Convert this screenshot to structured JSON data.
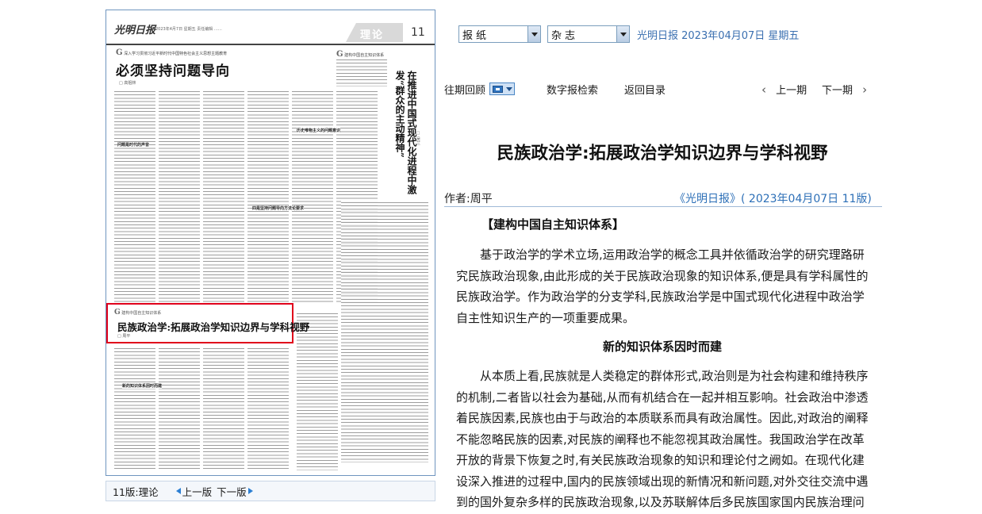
{
  "colors": {
    "highlight_border": "#e0001b",
    "link_blue": "#2c6fb7",
    "frame_blue": "#6f95bf"
  },
  "newspaper": {
    "logo": "光明日报",
    "meta_line": "2023年4月7日  星期五  责任编辑 ……",
    "section": "理论",
    "page_number": "11",
    "lead_kicker": "深入学习贯彻习近平新时代中国特色社会主义思想主题教育",
    "lead_headline": "必须坚持问题导向",
    "lead_byline": "□ 高祖林",
    "side_vertical_title": "在推进中国式现代化进程中激发“群众的主动精神”",
    "side_vertical_byline": "□ 吴兰",
    "side_kicker": "建构中国自主知识体系",
    "subheads": [
      "问题是时代的声音",
      "四是坚持问题导向方法论要求",
      "历史唯物主义的问题意识",
      "新的知识体系因时而建"
    ],
    "highlight_kicker": "建构中国自主知识体系",
    "highlight_title": "民族政治学:拓展政治学知识边界与学科视野",
    "highlight_byline": "□ 周平"
  },
  "edition_nav": {
    "current": "11版:理论",
    "prev_label": "上一版",
    "next_label": "下一版"
  },
  "toolbar": {
    "select_paper": "报纸",
    "select_magazine": "杂志",
    "date_line": "光明日报  2023年04月07日  星期五",
    "past_review": "往期回顾",
    "digital_search": "数字报检索",
    "back_to_toc": "返回目录",
    "prev_issue": "上一期",
    "next_issue": "下一期"
  },
  "article": {
    "title": "民族政治学:拓展政治学知识边界与学科视野",
    "author": "作者:周平",
    "source": "《光明日报》( 2023年04月07日  11版)",
    "section_heading": "【建构中国自主知识体系】",
    "para1": "基于政治学的学术立场,运用政治学的概念工具并依循政治学的研究理路研究民族政治现象,由此形成的关于民族政治现象的知识体系,便是具有学科属性的民族政治学。作为政治学的分支学科,民族政治学是中国式现代化进程中政治学自主性知识生产的一项重要成果。",
    "sub_heading": "新的知识体系因时而建",
    "para2": "从本质上看,民族就是人类稳定的群体形式,政治则是为社会构建和维持秩序的机制,二者皆以社会为基础,从而有机结合在一起并相互影响。社会政治中渗透着民族因素,民族也由于与政治的本质联系而具有政治属性。因此,对政治的阐释不能忽略民族的因素,对民族的阐释也不能忽视其政治属性。我国政治学在改革开放的背景下恢复之时,有关民族政治现象的知识和理论付之阙如。在现代化建设深入推进的过程中,国内的民族领域出现的新情况和新问题,对外交往交流中遇到的国外复杂多样的民族政治现象,以及苏联解体后多民族国家国内民族治理问题等,都需要基于政治"
  }
}
